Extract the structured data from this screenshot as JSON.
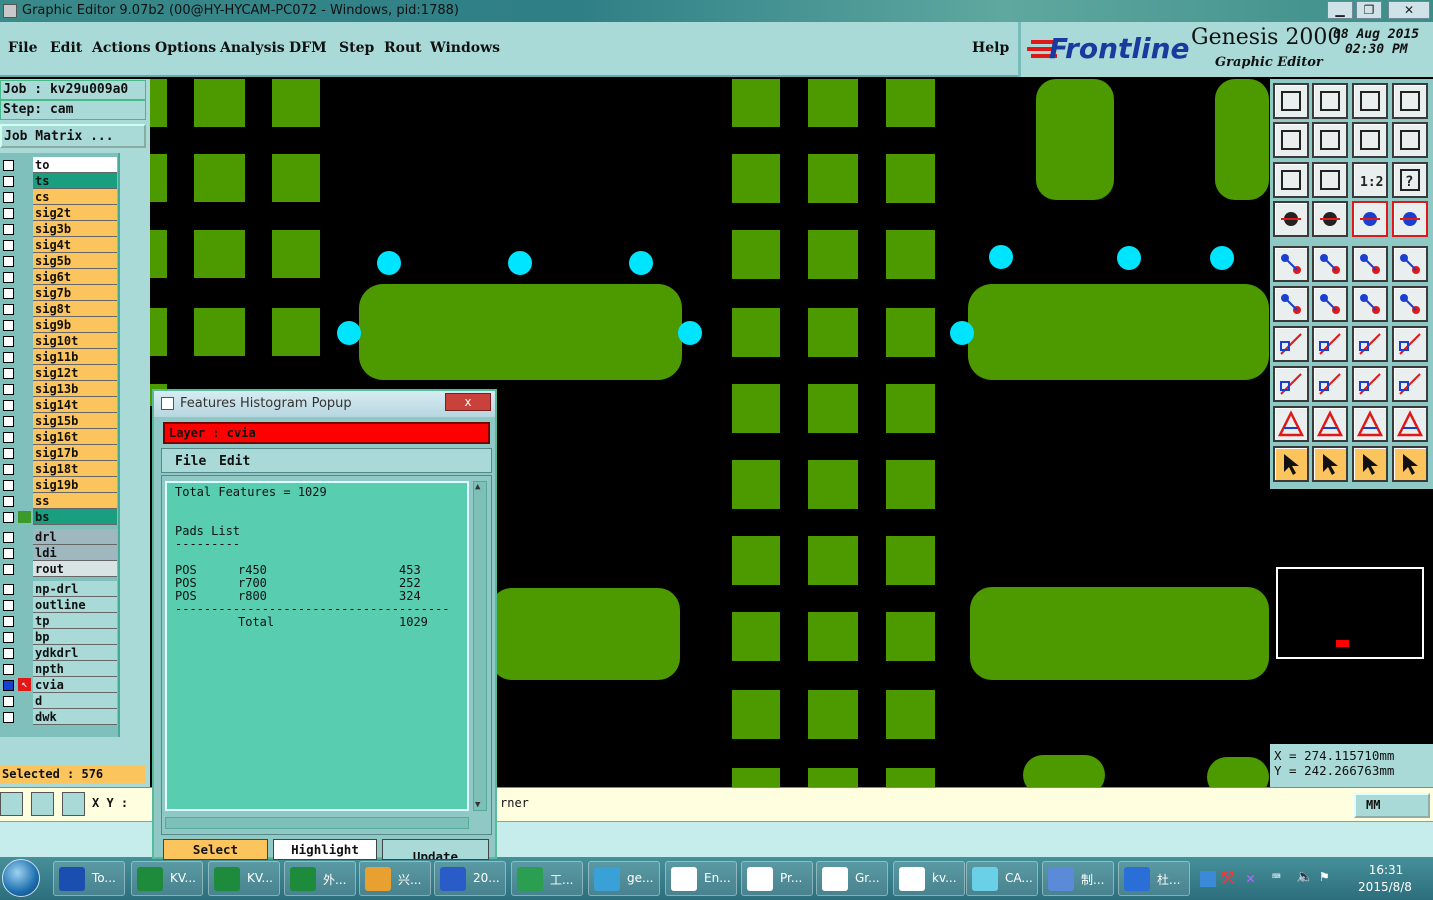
{
  "window": {
    "title": "Graphic Editor 9.07b2 (00@HY-HYCAM-PC072 - Windows, pid:1788)"
  },
  "menu": {
    "items": [
      "File",
      "Edit",
      "Actions",
      "Options",
      "Analysis",
      "DFM",
      "Step",
      "Rout",
      "Windows"
    ],
    "help": "Help"
  },
  "brand": {
    "logo": "Frontline",
    "product": "Genesis 2000",
    "subtitle": "Graphic Editor",
    "date": "08 Aug 2015",
    "time": "02:30 PM"
  },
  "job": {
    "job_line": "Job : kv29u009a0",
    "step_line": "Step: cam",
    "matrix_button": "Job Matrix ...",
    "selected": "Selected : 576"
  },
  "layers": [
    {
      "name": "to",
      "color": "#ffffff"
    },
    {
      "name": "ts",
      "color": "#199e80"
    },
    {
      "name": "cs",
      "color": "#fcc45c"
    },
    {
      "name": "sig2t",
      "color": "#fcc45c"
    },
    {
      "name": "sig3b",
      "color": "#fcc45c"
    },
    {
      "name": "sig4t",
      "color": "#fcc45c"
    },
    {
      "name": "sig5b",
      "color": "#fcc45c"
    },
    {
      "name": "sig6t",
      "color": "#fcc45c"
    },
    {
      "name": "sig7b",
      "color": "#fcc45c"
    },
    {
      "name": "sig8t",
      "color": "#fcc45c"
    },
    {
      "name": "sig9b",
      "color": "#fcc45c"
    },
    {
      "name": "sig10t",
      "color": "#fcc45c"
    },
    {
      "name": "sig11b",
      "color": "#fcc45c"
    },
    {
      "name": "sig12t",
      "color": "#fcc45c"
    },
    {
      "name": "sig13b",
      "color": "#fcc45c"
    },
    {
      "name": "sig14t",
      "color": "#fcc45c"
    },
    {
      "name": "sig15b",
      "color": "#fcc45c"
    },
    {
      "name": "sig16t",
      "color": "#fcc45c"
    },
    {
      "name": "sig17b",
      "color": "#fcc45c"
    },
    {
      "name": "sig18t",
      "color": "#fcc45c"
    },
    {
      "name": "sig19b",
      "color": "#fcc45c"
    },
    {
      "name": "ss",
      "color": "#fcc45c"
    },
    {
      "name": "bs",
      "color": "#199e80"
    },
    {
      "name": "drl",
      "color": "#9fb8c0"
    },
    {
      "name": "ldi",
      "color": "#9fb8c0"
    },
    {
      "name": "rout",
      "color": "#d8e4e4"
    },
    {
      "name": "np-drl",
      "color": "#a9dad8"
    },
    {
      "name": "outline",
      "color": "#a9dad8"
    },
    {
      "name": "tp",
      "color": "#a9dad8"
    },
    {
      "name": "bp",
      "color": "#a9dad8"
    },
    {
      "name": "ydkdrl",
      "color": "#a9dad8"
    },
    {
      "name": "npth",
      "color": "#a9dad8"
    },
    {
      "name": "cvia",
      "color": "#a9dad8"
    },
    {
      "name": "d",
      "color": "#a9dad8"
    },
    {
      "name": "dwk",
      "color": "#a9dad8"
    }
  ],
  "status": {
    "xy_label": "X Y :",
    "prompt_tail": "rner",
    "units": "MM"
  },
  "coords": {
    "x": "X = 274.115710mm",
    "y": "Y = 242.266763mm"
  },
  "popup": {
    "title": "Features Histogram Popup",
    "close": "x",
    "layer_line": "Layer : cvia",
    "menu": [
      "File",
      "Edit"
    ],
    "total_features": "Total Features = 1029",
    "list_title": "Pads List",
    "underline": "---------",
    "rows": [
      {
        "pol": "POS",
        "sym": "r450",
        "count": "453"
      },
      {
        "pol": "POS",
        "sym": "r700",
        "count": "252"
      },
      {
        "pol": "POS",
        "sym": "r800",
        "count": "324"
      }
    ],
    "separator": "--------------------------------------",
    "total_label": "Total",
    "total_value": "1029",
    "buttons": [
      "Select",
      "Highlight",
      "Update"
    ]
  },
  "taskbar": {
    "items": [
      "To...",
      "KV...",
      "KV...",
      "外...",
      "兴...",
      "20...",
      "工...",
      "ge...",
      "En...",
      "Pr...",
      "Gr...",
      "kv...",
      "CA...",
      "制...",
      "杜..."
    ],
    "clock_time": "16:31",
    "clock_date": "2015/8/8"
  }
}
